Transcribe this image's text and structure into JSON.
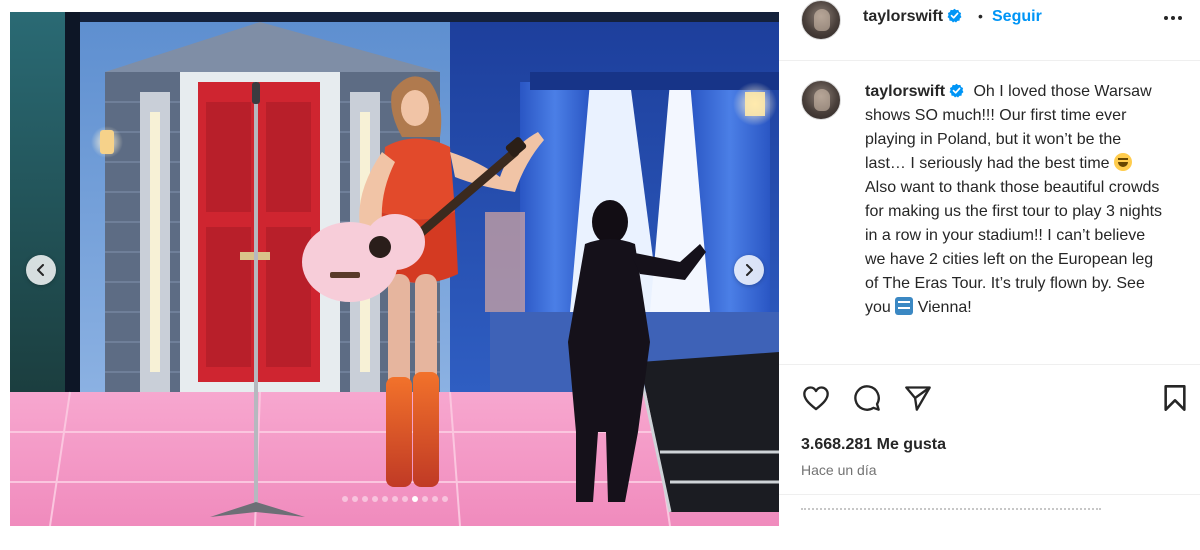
{
  "post": {
    "username": "taylorswift",
    "follow_label": "Seguir",
    "separator": "•",
    "caption_before_emoji": "Oh I loved those Warsaw shows SO much!!! Our first time ever playing in Poland, but it won’t be the last… I seriously had the best time",
    "caption_after_emoji": "Also want to thank those beautiful crowds for making us the first tour to play 3 nights in a row in your stadium!! I can’t believe we have 2 cities left on the European leg of The Eras Tour. It’s truly flown by. See you",
    "caption_end": "Vienna!",
    "likes": "3.668.281 Me gusta",
    "timestamp": "Hace un día"
  },
  "carousel": {
    "total_slides": 11,
    "active_index": 7
  },
  "icons": {
    "verified": "verified-badge-icon",
    "more": "more-options-icon",
    "like": "heart-icon",
    "comment": "comment-icon",
    "share": "send-icon",
    "save": "bookmark-icon",
    "prev": "chevron-left-icon",
    "next": "chevron-right-icon",
    "emoji_1": "grinning-squinting-face-emoji",
    "emoji_2": "soon-arrow-emoji"
  },
  "colors": {
    "link_blue": "#0095f6",
    "verified_blue": "#0095f6",
    "text": "#262626",
    "muted": "#737373"
  }
}
